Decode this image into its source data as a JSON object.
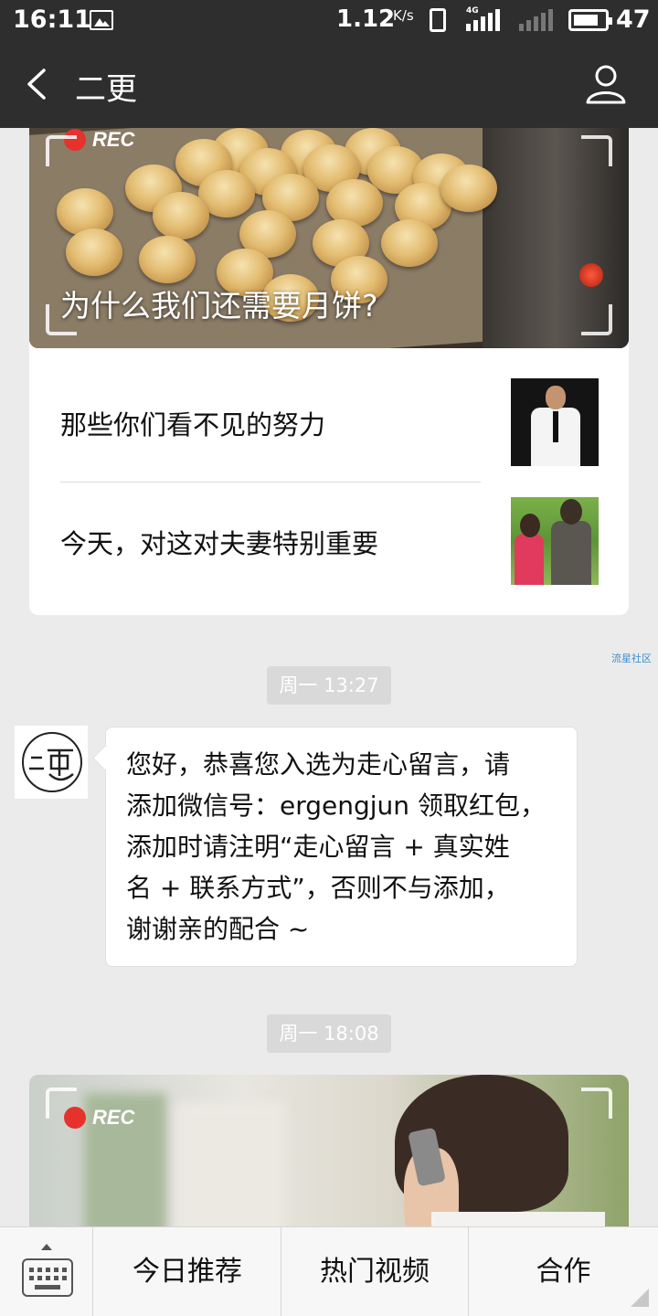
{
  "status_bar": {
    "time": "16:11",
    "network_speed": "1.12",
    "network_speed_unit": "K/s",
    "network_type": "4G",
    "battery_level": "47"
  },
  "header": {
    "title": "二更"
  },
  "article_card": {
    "rec_label": "REC",
    "hero_title": "为什么我们还需要月饼?",
    "items": [
      {
        "title": "那些你们看不见的努力"
      },
      {
        "title": "今天，对这对夫妻特别重要"
      }
    ]
  },
  "watermark": "流星社区",
  "messages": [
    {
      "timestamp": "周一 13:27"
    },
    {
      "lines": [
        "您好，恭喜您入选为走心留言，请",
        "添加微信号：ergengjun 领取红包，",
        "添加时请注明“走心留言 + 真实姓",
        "名 + 联系方式”，否则不与添加，",
        "谢谢亲的配合 ~"
      ]
    },
    {
      "timestamp": "周一 18:08"
    }
  ],
  "video_card": {
    "rec_label": "REC"
  },
  "bottom_menu": {
    "items": [
      "今日推荐",
      "热门视频",
      "合作"
    ]
  },
  "colors": {
    "header_bg": "#2e2e2e",
    "chat_bg": "#ebebeb",
    "rec_red": "#e5322d",
    "watermark_blue": "#3a8fd0"
  }
}
